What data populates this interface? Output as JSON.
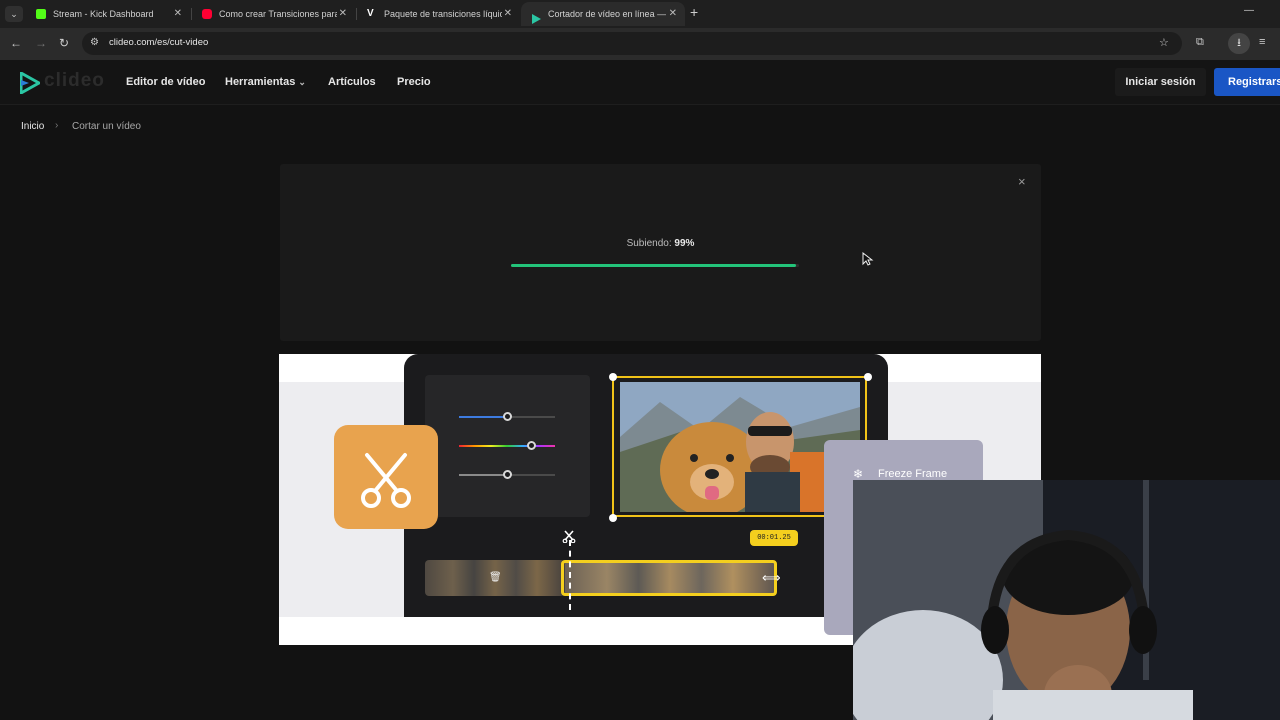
{
  "browser": {
    "tabs": [
      {
        "title": "Stream - Kick Dashboard",
        "favicon_color": "#53fc18",
        "active": false
      },
      {
        "title": "Como crear Transiciones para C",
        "favicon_color": "#ff0033",
        "active": false
      },
      {
        "title": "Paquete de transiciones líquida",
        "favicon_color": "#ffffff",
        "active": false
      },
      {
        "title": "Cortador de vídeo en línea — R",
        "favicon_color": "#2bc6a4",
        "active": true
      }
    ],
    "new_tab": "+",
    "url": "clideo.com/es/cut-video"
  },
  "site": {
    "logo_text": "clideo",
    "nav": {
      "video_editor": "Editor de vídeo",
      "tools": "Herramientas",
      "articles": "Artículos",
      "price": "Precio"
    },
    "login": "Iniciar sesión",
    "register": "Registrarse"
  },
  "breadcrumb": {
    "home": "Inicio",
    "separator": ">",
    "current": "Cortar un vídeo"
  },
  "upload": {
    "label": "Subiendo:",
    "percent_text": "99%",
    "progress": 0.99,
    "close": "×"
  },
  "illustration": {
    "time_badge": "00:01.25",
    "freeze_label": "Freeze Frame",
    "accent_color": "#f4cf1e",
    "tile_color": "#e8a34e"
  },
  "icons": {
    "close": "close-icon",
    "scissors": "scissors-icon",
    "freeze": "snowflake-icon",
    "trash": "trash-icon"
  }
}
